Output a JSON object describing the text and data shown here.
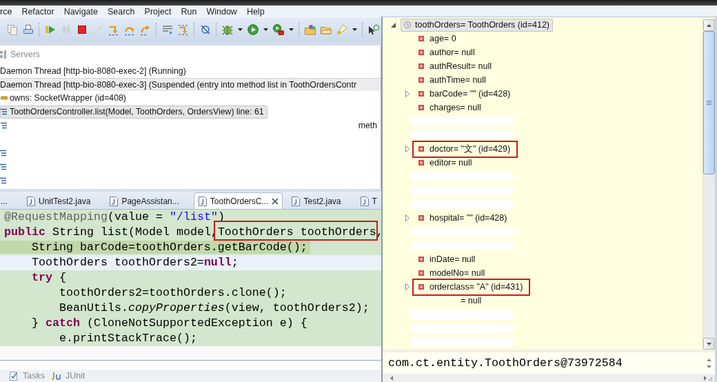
{
  "menu": [
    {
      "label": "rce"
    },
    {
      "label": "Refactor"
    },
    {
      "label": "Navigate"
    },
    {
      "label": "Search"
    },
    {
      "label": "Project"
    },
    {
      "label": "Run"
    },
    {
      "label": "Window"
    },
    {
      "label": "Help"
    }
  ],
  "debug_view": {
    "tab": "Servers",
    "threads": [
      {
        "label": "Daemon Thread [http-bio-8080-exec-2] (Running)",
        "selected": false,
        "hovered": false
      },
      {
        "label": "Daemon Thread [http-bio-8080-exec-3] (Suspended (entry into method list in ToothOrdersContr",
        "selected": false,
        "hovered": true,
        "children": [
          {
            "kind": "monitor",
            "label": "owns: SocketWrapper  (id=408)",
            "selected": false
          },
          {
            "kind": "frame",
            "label": "ToothOrdersController.list(Model, ToothOrders, OrdersView) line: 61",
            "selected": true
          },
          {
            "kind": "fragment",
            "label": "meth",
            "selected": false
          },
          {
            "kind": "blank"
          },
          {
            "kind": "erased"
          },
          {
            "kind": "erased"
          },
          {
            "kind": "erased"
          }
        ]
      }
    ]
  },
  "editor": {
    "tabs": [
      {
        "label": "...",
        "file_icon": false,
        "selected": false
      },
      {
        "label": "UnitTest2.java",
        "file_icon": true,
        "selected": false
      },
      {
        "label": "PageAssistan...",
        "file_icon": true,
        "selected": false
      },
      {
        "label": "ToothOrdersC...",
        "file_icon": true,
        "selected": true
      },
      {
        "label": "Test2.java",
        "file_icon": true,
        "selected": false
      },
      {
        "label": "T",
        "file_icon": true,
        "selected": false
      }
    ],
    "lines": [
      {
        "kind": "covered",
        "segments": [
          {
            "kind": "annotation",
            "text": "@RequestMapping",
            "annotated": false
          },
          {
            "kind": "plain",
            "text": "(value = ",
            "annotated": false
          },
          {
            "kind": "string",
            "text": "\"/list\"",
            "annotated": false
          },
          {
            "kind": "plain",
            "text": ")",
            "annotated": false
          }
        ]
      },
      {
        "kind": "covered",
        "segments": [
          {
            "kind": "keyword",
            "text": "public",
            "annotated": false
          },
          {
            "kind": "plain",
            "text": " String list(Model model,",
            "annotated": false
          },
          {
            "kind": "plain",
            "text": "ToothOrders toothOrders",
            "annotated": true
          },
          {
            "kind": "plain",
            "text": ",",
            "annotated": false
          }
        ]
      },
      {
        "kind": "instruction",
        "segments": [
          {
            "kind": "plain",
            "text": "    String barCode=toothOrders.getBarCode();",
            "annotated": false
          }
        ]
      },
      {
        "kind": "cursor",
        "segments": [
          {
            "kind": "plain",
            "text": "    ToothOrders toothOrders2=",
            "annotated": false
          },
          {
            "kind": "keyword",
            "text": "null",
            "annotated": false
          },
          {
            "kind": "plain",
            "text": ";",
            "annotated": false
          }
        ]
      },
      {
        "kind": "covered",
        "segments": [
          {
            "kind": "keyword",
            "text": "    try",
            "annotated": false
          },
          {
            "kind": "plain",
            "text": " {",
            "annotated": false
          }
        ]
      },
      {
        "kind": "covered",
        "segments": [
          {
            "kind": "plain",
            "text": "        toothOrders2=toothOrders.clone();",
            "annotated": false
          }
        ]
      },
      {
        "kind": "covered",
        "segments": [
          {
            "kind": "plain",
            "text": "        BeanUtils.",
            "annotated": false
          },
          {
            "kind": "static",
            "text": "copyProperties",
            "annotated": false
          },
          {
            "kind": "plain",
            "text": "(view, toothOrders2);",
            "annotated": false
          }
        ]
      },
      {
        "kind": "covered",
        "segments": [
          {
            "kind": "plain",
            "text": "    } ",
            "annotated": false
          },
          {
            "kind": "keyword",
            "text": "catch",
            "annotated": false
          },
          {
            "kind": "plain",
            "text": " (CloneNotSupportedException e) {",
            "annotated": false
          }
        ]
      },
      {
        "kind": "covered",
        "segments": [
          {
            "kind": "plain",
            "text": "        e.printStackTrace();",
            "annotated": false
          }
        ]
      }
    ]
  },
  "bottom_tabs": [
    {
      "kind": "tasks",
      "label": "Tasks"
    },
    {
      "kind": "junit",
      "label": "JUnit"
    }
  ],
  "variables": {
    "root": {
      "label": "toothOrders= ToothOrders  (id=412)",
      "expanded": true,
      "selected": true,
      "children": [
        {
          "kind": "field",
          "label": "age= 0",
          "expandable": false,
          "annotated": false
        },
        {
          "kind": "field",
          "label": "author= null",
          "expandable": false,
          "annotated": false
        },
        {
          "kind": "field",
          "label": "authResult= null",
          "expandable": false,
          "annotated": false
        },
        {
          "kind": "field",
          "label": "authTime= null",
          "expandable": false,
          "annotated": false
        },
        {
          "kind": "field",
          "label": "barCode= \"\" (id=428)",
          "expandable": true,
          "annotated": false
        },
        {
          "kind": "field",
          "label": "charges= null",
          "expandable": false,
          "annotated": false
        },
        {
          "kind": "erased"
        },
        {
          "kind": "erased"
        },
        {
          "kind": "field",
          "label": "doctor= \"文\" (id=429)",
          "expandable": true,
          "annotated": true
        },
        {
          "kind": "field",
          "label": "editor= null",
          "expandable": false,
          "annotated": false
        },
        {
          "kind": "erased"
        },
        {
          "kind": "erased"
        },
        {
          "kind": "erased"
        },
        {
          "kind": "field",
          "label": "hospital= \"\" (id=428)",
          "expandable": true,
          "annotated": false
        },
        {
          "kind": "erased"
        },
        {
          "kind": "erased"
        },
        {
          "kind": "field",
          "label": "inDate= null",
          "expandable": false,
          "annotated": false
        },
        {
          "kind": "field",
          "label": "modelNo= null",
          "expandable": false,
          "annotated": false
        },
        {
          "kind": "field",
          "label": "orderclass= \"A\" (id=431)",
          "expandable": true,
          "annotated": true
        },
        {
          "kind": "fragment",
          "label": "= null"
        },
        {
          "kind": "erased"
        },
        {
          "kind": "erased"
        },
        {
          "kind": "erased"
        }
      ]
    },
    "detail": "com.ct.entity.ToothOrders@73972584"
  }
}
